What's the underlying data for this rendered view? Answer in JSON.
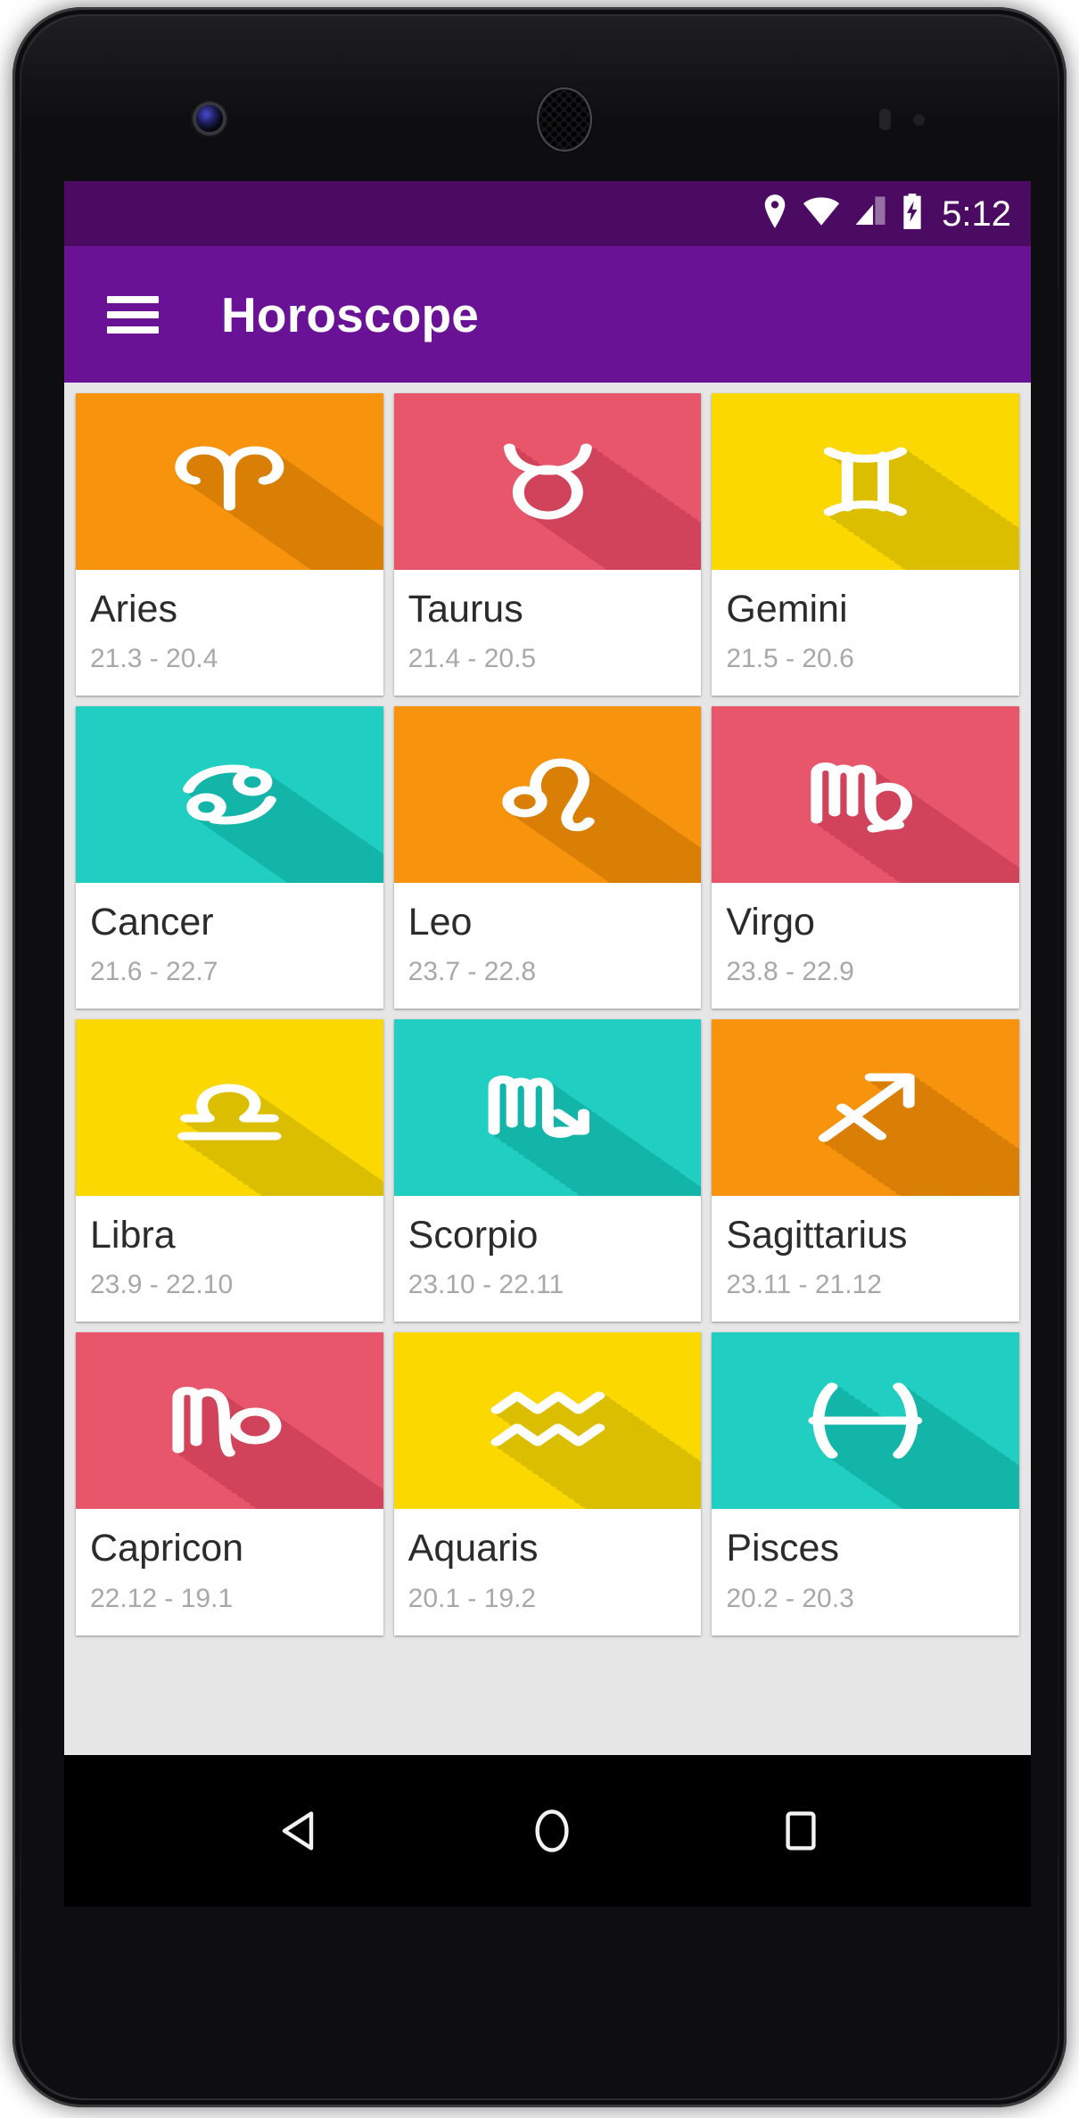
{
  "statusbar": {
    "time": "5:12",
    "icons": [
      "location-pin-icon",
      "wifi-icon",
      "cell-signal-icon",
      "battery-charging-icon"
    ],
    "background": "#4B0B62"
  },
  "appbar": {
    "menu_icon": "hamburger-menu-icon",
    "title": "Horoscope",
    "background": "#6A1296"
  },
  "content": {
    "background": "#E6E6E6",
    "signs": [
      {
        "name": "Aries",
        "range": "21.3 - 20.4",
        "glyph": "aries-icon",
        "color": "#F7930D",
        "shadow": "#D97F06"
      },
      {
        "name": "Taurus",
        "range": "21.4 - 20.5",
        "glyph": "taurus-icon",
        "color": "#E8566B",
        "shadow": "#D0435A"
      },
      {
        "name": "Gemini",
        "range": "21.5 - 20.6",
        "glyph": "gemini-icon",
        "color": "#FBD800",
        "shadow": "#DCBE00"
      },
      {
        "name": "Cancer",
        "range": "21.6 - 22.7",
        "glyph": "cancer-icon",
        "color": "#21CFC2",
        "shadow": "#14B5A9"
      },
      {
        "name": "Leo",
        "range": "23.7 - 22.8",
        "glyph": "leo-icon",
        "color": "#F7930D",
        "shadow": "#D97F06"
      },
      {
        "name": "Virgo",
        "range": "23.8 - 22.9",
        "glyph": "virgo-icon",
        "color": "#E8566B",
        "shadow": "#D0435A"
      },
      {
        "name": "Libra",
        "range": "23.9 - 22.10",
        "glyph": "libra-icon",
        "color": "#FBD800",
        "shadow": "#DCBE00"
      },
      {
        "name": "Scorpio",
        "range": "23.10 - 22.11",
        "glyph": "scorpio-icon",
        "color": "#21CFC2",
        "shadow": "#14B5A9"
      },
      {
        "name": "Sagittarius",
        "range": "23.11 - 21.12",
        "glyph": "sagittarius-icon",
        "color": "#F7930D",
        "shadow": "#D97F06"
      },
      {
        "name": "Capricon",
        "range": "22.12 - 19.1",
        "glyph": "capricorn-icon",
        "color": "#E8566B",
        "shadow": "#D0435A"
      },
      {
        "name": "Aquaris",
        "range": "20.1 - 19.2",
        "glyph": "aquarius-icon",
        "color": "#FBD800",
        "shadow": "#DCBE00"
      },
      {
        "name": "Pisces",
        "range": "20.2 - 20.3",
        "glyph": "pisces-icon",
        "color": "#21CFC2",
        "shadow": "#14B5A9"
      }
    ]
  },
  "navbar": {
    "back": "back-triangle-icon",
    "home": "home-circle-icon",
    "recents": "recents-square-icon"
  }
}
